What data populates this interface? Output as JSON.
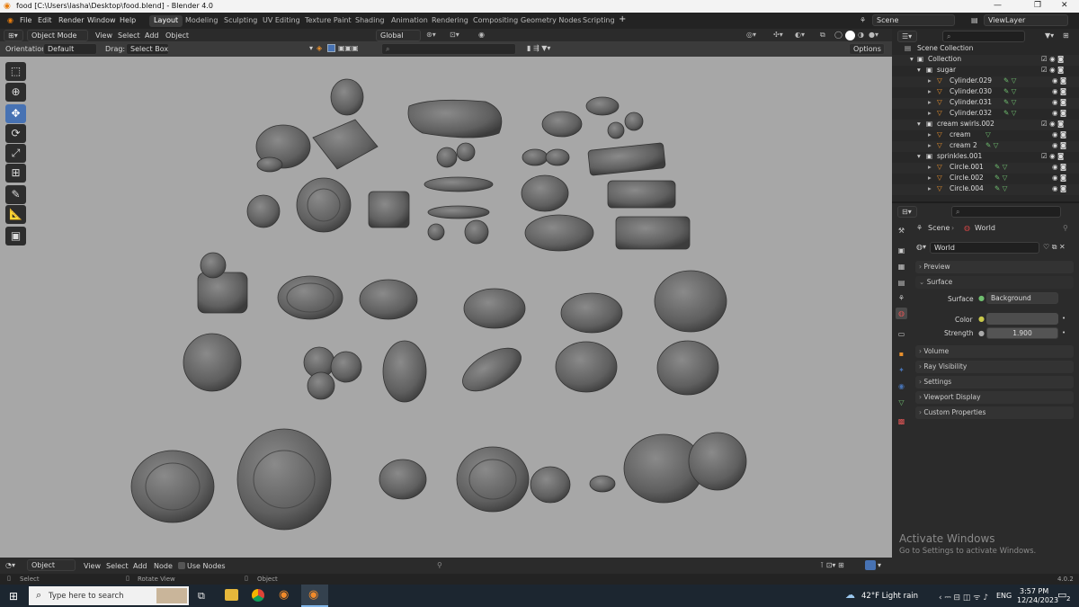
{
  "window": {
    "title": "food [C:\\Users\\lasha\\Desktop\\food.blend] - Blender 4.0",
    "controls": [
      "—",
      "❐",
      "✕"
    ]
  },
  "menus": [
    "File",
    "Edit",
    "Render",
    "Window",
    "Help"
  ],
  "workspaces": [
    "Layout",
    "Modeling",
    "Sculpting",
    "UV Editing",
    "Texture Paint",
    "Shading",
    "Animation",
    "Rendering",
    "Compositing",
    "Geometry Nodes",
    "Scripting"
  ],
  "workspace_add": "+",
  "scene": {
    "label": "Scene",
    "view_layer": "ViewLayer"
  },
  "header3d": {
    "mode": "Object Mode",
    "menus": [
      "View",
      "Select",
      "Add",
      "Object"
    ],
    "transform": "Global",
    "orientation_label": "Orientation:",
    "orientation_value": "Default",
    "drag_label": "Drag:",
    "drag_value": "Select Box",
    "options": "Options"
  },
  "outliner": {
    "rows": [
      {
        "name": "Scene Collection",
        "type": "scene"
      },
      {
        "name": "Collection",
        "type": "collection"
      },
      {
        "name": "sugar",
        "type": "collection"
      },
      {
        "name": "Cylinder.029",
        "type": "object"
      },
      {
        "name": "Cylinder.030",
        "type": "object"
      },
      {
        "name": "Cylinder.031",
        "type": "object"
      },
      {
        "name": "Cylinder.032",
        "type": "object"
      },
      {
        "name": "cream swirls.002",
        "type": "collection"
      },
      {
        "name": "cream",
        "type": "object"
      },
      {
        "name": "cream 2",
        "type": "object"
      },
      {
        "name": "sprinkles.001",
        "type": "collection"
      },
      {
        "name": "Circle.001",
        "type": "object"
      },
      {
        "name": "Circle.002",
        "type": "object"
      },
      {
        "name": "Circle.004",
        "type": "object"
      }
    ]
  },
  "properties": {
    "breadcrumb_scene": "Scene",
    "breadcrumb_world": "World",
    "world_name": "World",
    "panels_top": [
      "Preview",
      "Surface"
    ],
    "surface_label": "Surface",
    "surface_value": "Background",
    "color_label": "Color",
    "strength_label": "Strength",
    "strength_value": "1.900",
    "panels_bottom": [
      "Volume",
      "Ray Visibility",
      "Settings",
      "Viewport Display",
      "Custom Properties"
    ]
  },
  "watermark": {
    "line1": "Activate Windows",
    "line2": "Go to Settings to activate Windows."
  },
  "bottom_header": {
    "mode": "Object",
    "menus": [
      "View",
      "Select",
      "Add",
      "Node"
    ],
    "use_nodes": "Use Nodes"
  },
  "statusbar": {
    "select": "Select",
    "rotate": "Rotate View",
    "object": "Object",
    "version": "4.0.2"
  },
  "taskbar": {
    "search_placeholder": "Type here to search",
    "weather": "42°F  Light rain",
    "lang": "ENG",
    "time": "3:57 PM",
    "date": "12/24/2023",
    "notifications": "2"
  },
  "colors": {
    "accent": "#4772b3",
    "viewport": "#a7a7a7",
    "orange": "#e8902d",
    "green": "#6fbe6f"
  }
}
